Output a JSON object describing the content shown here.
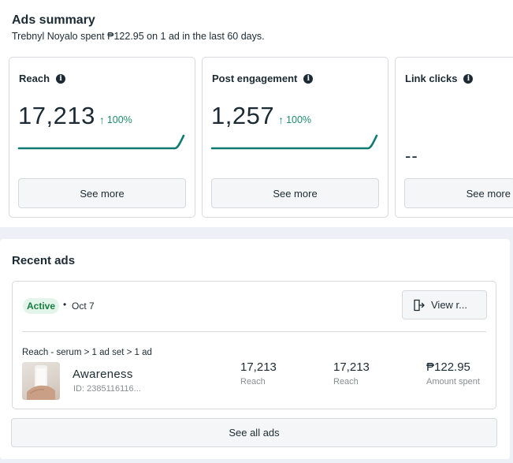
{
  "summary": {
    "title": "Ads summary",
    "subtitle": "Trebnyl Noyalo spent ₱122.95 on 1 ad in the last 60 days."
  },
  "cards": [
    {
      "title": "Reach",
      "value": "17,213",
      "change": "100%",
      "trend": [
        0,
        0,
        0,
        0,
        0,
        0,
        0,
        0,
        0,
        0,
        0,
        0,
        0,
        0,
        0,
        0,
        0,
        0,
        0,
        1
      ],
      "button": "See more"
    },
    {
      "title": "Post engagement",
      "value": "1,257",
      "change": "100%",
      "trend": [
        0,
        0,
        0,
        0,
        0,
        0,
        0,
        0,
        0,
        0,
        0,
        0,
        0,
        0,
        0,
        0,
        0,
        0,
        0,
        1
      ],
      "button": "See more"
    },
    {
      "title": "Link clicks",
      "value": "--",
      "button": "See more"
    }
  ],
  "recent": {
    "title": "Recent ads",
    "ad": {
      "status": "Active",
      "date": "Oct 7",
      "view_label": "View r...",
      "breadcrumb": "Reach - serum > 1 ad set > 1 ad",
      "name": "Awareness",
      "id": "ID: 2385116116...",
      "stats": [
        {
          "value": "17,213",
          "label": "Reach"
        },
        {
          "value": "17,213",
          "label": "Reach"
        },
        {
          "value": "₱122.95",
          "label": "Amount spent"
        }
      ]
    },
    "see_all": "See all ads"
  },
  "icons": {
    "info": "info-icon",
    "trend": "arrow-up-icon",
    "view": "view-exit-icon"
  },
  "colors": {
    "accent_teal": "#0e7a6f",
    "positive_green": "#1f8c6a",
    "active_badge_bg": "#e3f4ea",
    "active_badge_text": "#177d3f"
  }
}
